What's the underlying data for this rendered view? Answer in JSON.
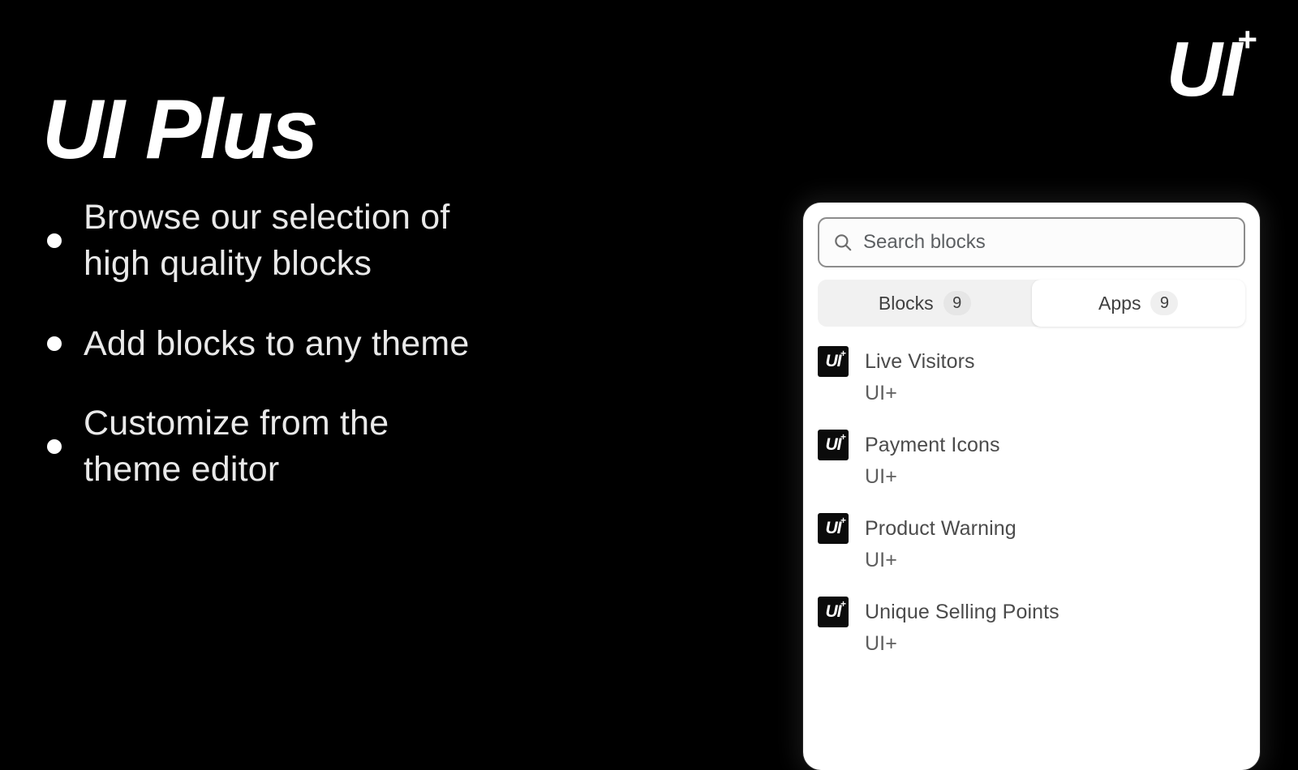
{
  "header": {
    "title": "UI Plus",
    "logo_text": "UI",
    "logo_superscript": "+"
  },
  "features": {
    "items": [
      {
        "text": "Browse our selection of\nhigh quality blocks"
      },
      {
        "text": "Add blocks to any theme"
      },
      {
        "text": "Customize from the\ntheme editor"
      }
    ]
  },
  "panel": {
    "search": {
      "placeholder": "Search blocks",
      "value": "",
      "icon": "search-icon"
    },
    "tabs": [
      {
        "label": "Blocks",
        "count": "9",
        "selected": false
      },
      {
        "label": "Apps",
        "count": "9",
        "selected": true
      }
    ],
    "results": [
      {
        "icon_text": "UI",
        "icon_plus": "+",
        "title": "Live Visitors",
        "subtitle": "UI+"
      },
      {
        "icon_text": "UI",
        "icon_plus": "+",
        "title": "Payment Icons",
        "subtitle": "UI+"
      },
      {
        "icon_text": "UI",
        "icon_plus": "+",
        "title": "Product Warning",
        "subtitle": "UI+"
      },
      {
        "icon_text": "UI",
        "icon_plus": "+",
        "title": "Unique Selling Points",
        "subtitle": "UI+"
      }
    ]
  },
  "colors": {
    "background": "#000000",
    "panel_background": "#ffffff",
    "text_on_dark": "#e9e9e9",
    "tab_track": "#f1f1f1",
    "badge": "#e6e6e6",
    "icon_tile": "#0b0b0b"
  }
}
